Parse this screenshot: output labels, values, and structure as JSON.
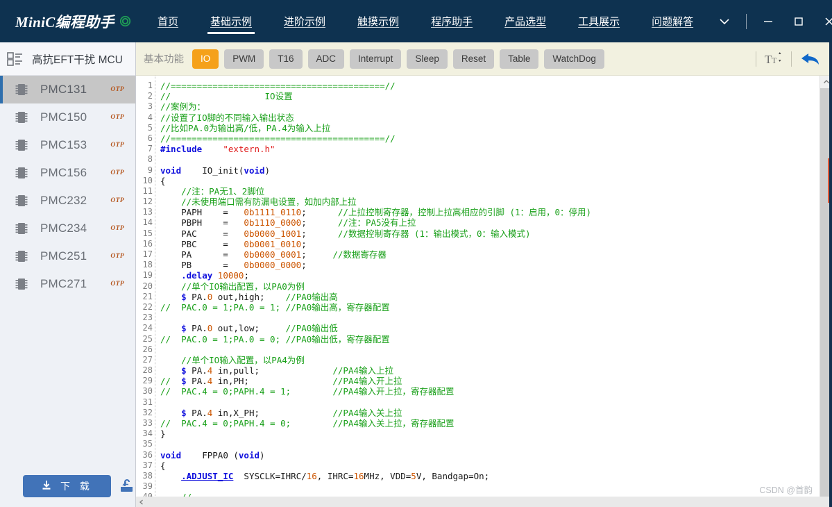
{
  "titlebar": {
    "brand": "MiniC编程助手",
    "brand_logo_icon": "green-circle-logo-icon",
    "nav": [
      {
        "label": "首页",
        "active": false
      },
      {
        "label": "基础示例",
        "active": true
      },
      {
        "label": "进阶示例",
        "active": false
      },
      {
        "label": "触摸示例",
        "active": false
      },
      {
        "label": "程序助手",
        "active": false
      },
      {
        "label": "产品选型",
        "active": false
      },
      {
        "label": "工具展示",
        "active": false
      },
      {
        "label": "问题解答",
        "active": false
      }
    ],
    "window_controls": [
      {
        "name": "chevron-down-icon",
        "glyph": "⌄"
      },
      {
        "name": "minimize-icon",
        "glyph": "—"
      },
      {
        "name": "maximize-icon",
        "glyph": "□"
      },
      {
        "name": "close-icon",
        "glyph": "✕"
      }
    ]
  },
  "sidebar": {
    "header_icon": "list-grid-icon",
    "header_title": "高抗EFT干扰 MCU",
    "chips": [
      {
        "name": "PMC131",
        "tag": "OTP",
        "selected": true
      },
      {
        "name": "PMC150",
        "tag": "OTP",
        "selected": false
      },
      {
        "name": "PMC153",
        "tag": "OTP",
        "selected": false
      },
      {
        "name": "PMC156",
        "tag": "OTP",
        "selected": false
      },
      {
        "name": "PMC232",
        "tag": "OTP",
        "selected": false
      },
      {
        "name": "PMC234",
        "tag": "OTP",
        "selected": false
      },
      {
        "name": "PMC251",
        "tag": "OTP",
        "selected": false
      },
      {
        "name": "PMC271",
        "tag": "OTP",
        "selected": false
      }
    ],
    "download_button": "下 载",
    "download_icon": "download-arrow-icon",
    "flash_icon": "flash-programmer-icon"
  },
  "toolbar": {
    "label": "基本功能",
    "buttons": [
      {
        "label": "IO",
        "active": true
      },
      {
        "label": "PWM",
        "active": false
      },
      {
        "label": "T16",
        "active": false
      },
      {
        "label": "ADC",
        "active": false
      },
      {
        "label": "Interrupt",
        "active": false
      },
      {
        "label": "Sleep",
        "active": false
      },
      {
        "label": "Reset",
        "active": false
      },
      {
        "label": "Table",
        "active": false
      },
      {
        "label": "WatchDog",
        "active": false
      }
    ],
    "font_size_icon": "font-size-icon",
    "font_size_glyph": "Tt",
    "undo_icon": "undo-arrow-icon"
  },
  "editor": {
    "first_line": 1,
    "last_visible_line": 40,
    "watermark": "CSDN @首韵",
    "scroll_up_icon": "chevron-up-icon",
    "scroll_left_icon": "chevron-left-icon",
    "lines": [
      [
        {
          "t": "//=========================================//",
          "c": "cm"
        }
      ],
      [
        {
          "t": "//                  IO设置",
          "c": "cm"
        }
      ],
      [
        {
          "t": "//案例为：",
          "c": "cm"
        }
      ],
      [
        {
          "t": "//设置了IO脚的不同输入输出状态",
          "c": "cm"
        }
      ],
      [
        {
          "t": "//比如PA.0为输出高/低，PA.4为输入上拉",
          "c": "cm"
        }
      ],
      [
        {
          "t": "//=========================================//",
          "c": "cm"
        }
      ],
      [
        {
          "t": "#include",
          "c": "pp"
        },
        {
          "t": "    ",
          "c": "id"
        },
        {
          "t": "\"extern.h\"",
          "c": "st"
        }
      ],
      [
        {
          "t": "",
          "c": "id"
        }
      ],
      [
        {
          "t": "void",
          "c": "kw"
        },
        {
          "t": "    IO_init(",
          "c": "id"
        },
        {
          "t": "void",
          "c": "kw"
        },
        {
          "t": ")",
          "c": "id"
        }
      ],
      [
        {
          "t": "{",
          "c": "id"
        }
      ],
      [
        {
          "t": "    ",
          "c": "id"
        },
        {
          "t": "//注：PA无1、2脚位",
          "c": "cm"
        }
      ],
      [
        {
          "t": "    ",
          "c": "id"
        },
        {
          "t": "//未使用端口需有防漏电设置，如加内部上拉",
          "c": "cm"
        }
      ],
      [
        {
          "t": "    PAPH    =   ",
          "c": "id"
        },
        {
          "t": "0b1111_0110",
          "c": "num"
        },
        {
          "t": ";      ",
          "c": "id"
        },
        {
          "t": "//上拉控制寄存器，控制上拉高相应的引脚 (1：启用，0：停用)",
          "c": "cm"
        }
      ],
      [
        {
          "t": "    PBPH    =   ",
          "c": "id"
        },
        {
          "t": "0b1110_0000",
          "c": "num"
        },
        {
          "t": ";      ",
          "c": "id"
        },
        {
          "t": "//注：PA5没有上拉",
          "c": "cm"
        }
      ],
      [
        {
          "t": "    PAC     =   ",
          "c": "id"
        },
        {
          "t": "0b0000_1001",
          "c": "num"
        },
        {
          "t": ";      ",
          "c": "id"
        },
        {
          "t": "//数据控制寄存器 (1：输出模式，0：输入模式)",
          "c": "cm"
        }
      ],
      [
        {
          "t": "    PBC     =   ",
          "c": "id"
        },
        {
          "t": "0b0001_0010",
          "c": "num"
        },
        {
          "t": ";",
          "c": "id"
        }
      ],
      [
        {
          "t": "    PA      =   ",
          "c": "id"
        },
        {
          "t": "0b0000_0001",
          "c": "num"
        },
        {
          "t": ";     ",
          "c": "id"
        },
        {
          "t": "//数据寄存器",
          "c": "cm"
        }
      ],
      [
        {
          "t": "    PB      =   ",
          "c": "id"
        },
        {
          "t": "0b0000_0000",
          "c": "num"
        },
        {
          "t": ";",
          "c": "id"
        }
      ],
      [
        {
          "t": "    ",
          "c": "id"
        },
        {
          "t": ".delay",
          "c": "blu"
        },
        {
          "t": " ",
          "c": "id"
        },
        {
          "t": "10000",
          "c": "num"
        },
        {
          "t": ";",
          "c": "id"
        }
      ],
      [
        {
          "t": "    ",
          "c": "id"
        },
        {
          "t": "//单个IO输出配置，以PA0为例",
          "c": "cm"
        }
      ],
      [
        {
          "t": "    ",
          "c": "id"
        },
        {
          "t": "$",
          "c": "blu"
        },
        {
          "t": " PA.",
          "c": "id"
        },
        {
          "t": "0",
          "c": "num"
        },
        {
          "t": " out,high;    ",
          "c": "id"
        },
        {
          "t": "//PA0输出高",
          "c": "cm"
        }
      ],
      [
        {
          "t": "//  PAC.0 = 1;PA.0 = 1; //PA0输出高，寄存器配置",
          "c": "cm"
        }
      ],
      [
        {
          "t": "",
          "c": "id"
        }
      ],
      [
        {
          "t": "    ",
          "c": "id"
        },
        {
          "t": "$",
          "c": "blu"
        },
        {
          "t": " PA.",
          "c": "id"
        },
        {
          "t": "0",
          "c": "num"
        },
        {
          "t": " out,low;     ",
          "c": "id"
        },
        {
          "t": "//PA0输出低",
          "c": "cm"
        }
      ],
      [
        {
          "t": "//  PAC.0 = 1;PA.0 = 0; //PA0输出低，寄存器配置",
          "c": "cm"
        }
      ],
      [
        {
          "t": "",
          "c": "id"
        }
      ],
      [
        {
          "t": "    ",
          "c": "id"
        },
        {
          "t": "//单个IO输入配置，以PA4为例",
          "c": "cm"
        }
      ],
      [
        {
          "t": "    ",
          "c": "id"
        },
        {
          "t": "$",
          "c": "blu"
        },
        {
          "t": " PA.",
          "c": "id"
        },
        {
          "t": "4",
          "c": "num"
        },
        {
          "t": " in,pull;              ",
          "c": "id"
        },
        {
          "t": "//PA4输入上拉",
          "c": "cm"
        }
      ],
      [
        {
          "t": "//  ",
          "c": "cm"
        },
        {
          "t": "$",
          "c": "blu"
        },
        {
          "t": " PA.",
          "c": "id"
        },
        {
          "t": "4",
          "c": "num"
        },
        {
          "t": " in,PH;                ",
          "c": "id"
        },
        {
          "t": "//PA4输入开上拉",
          "c": "cm"
        }
      ],
      [
        {
          "t": "//  PAC.4 = 0;PAPH.4 = 1;        //PA4输入开上拉，寄存器配置",
          "c": "cm"
        }
      ],
      [
        {
          "t": "",
          "c": "id"
        }
      ],
      [
        {
          "t": "    ",
          "c": "id"
        },
        {
          "t": "$",
          "c": "blu"
        },
        {
          "t": " PA.",
          "c": "id"
        },
        {
          "t": "4",
          "c": "num"
        },
        {
          "t": " in,X_PH;              ",
          "c": "id"
        },
        {
          "t": "//PA4输入关上拉",
          "c": "cm"
        }
      ],
      [
        {
          "t": "//  PAC.4 = 0;PAPH.4 = 0;        //PA4输入关上拉，寄存器配置",
          "c": "cm"
        }
      ],
      [
        {
          "t": "}",
          "c": "id"
        }
      ],
      [
        {
          "t": "",
          "c": "id"
        }
      ],
      [
        {
          "t": "void",
          "c": "kw"
        },
        {
          "t": "    FPPA0 (",
          "c": "id"
        },
        {
          "t": "void",
          "c": "kw"
        },
        {
          "t": ")",
          "c": "id"
        }
      ],
      [
        {
          "t": "{",
          "c": "id"
        }
      ],
      [
        {
          "t": "    ",
          "c": "id"
        },
        {
          "t": ".ADJUST_IC",
          "c": "lnk"
        },
        {
          "t": "  SYSCLK=IHRC/",
          "c": "id"
        },
        {
          "t": "16",
          "c": "num"
        },
        {
          "t": ", IHRC=",
          "c": "id"
        },
        {
          "t": "16",
          "c": "num"
        },
        {
          "t": "MHz, VDD=",
          "c": "id"
        },
        {
          "t": "5",
          "c": "num"
        },
        {
          "t": "V, Bandgap=On;",
          "c": "id"
        }
      ],
      [
        {
          "t": "",
          "c": "id"
        }
      ],
      [
        {
          "t": "    ",
          "c": "id"
        },
        {
          "t": "//...",
          "c": "cm"
        }
      ]
    ]
  },
  "colors": {
    "titlebar_bg": "#0e3250",
    "sidebar_bg": "#eef1f6",
    "toolbar_bg": "#f2f1e0",
    "accent_orange": "#f5a11a",
    "accent_blue": "#4173b8",
    "comment_green": "#19a019",
    "keyword_blue": "#1111dd",
    "string_red": "#e01b1b",
    "number_orange": "#cc5500"
  }
}
